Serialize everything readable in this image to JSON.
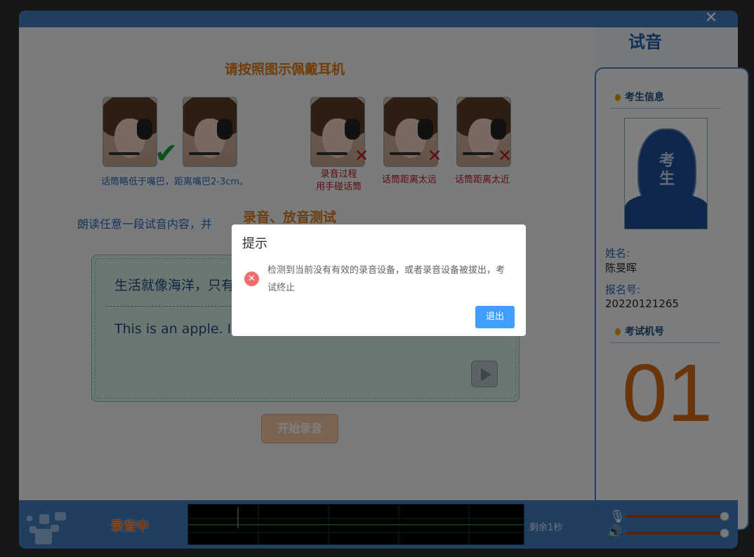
{
  "window": {
    "close_icon": "close-icon"
  },
  "headset": {
    "title": "请按照图示佩戴耳机",
    "correct_caption": "话筒略低于嘴巴，距离嘴巴2-3cm。",
    "wrong_captions": [
      {
        "line1": "录音过程",
        "line2": "用手碰话筒"
      },
      {
        "line1": "话筒距离太远",
        "line2": ""
      },
      {
        "line1": "话筒距离太近",
        "line2": ""
      }
    ],
    "marks": {
      "ok": "✔",
      "bad": "✕"
    }
  },
  "test": {
    "title": "录音、放音测试",
    "instruction": "朗读任意一段试音内容，并",
    "sample_cn": "生活就像海洋，只有",
    "sample_en": "This is an apple. I l",
    "start_button": "开始录音"
  },
  "sidebar": {
    "title": "试音",
    "candidate_header": "考生信息",
    "photo_label": "考生",
    "name_label": "姓名:",
    "name_value": "陈旻晖",
    "reg_label": "报名号:",
    "reg_value": "20220121265",
    "seat_header": "考试机号",
    "seat_value": "01"
  },
  "bottom": {
    "status": "录音中",
    "remaining": "剩余1秒",
    "mic_level": 0.95,
    "speaker_level": 0.95
  },
  "dialog": {
    "title": "提示",
    "message": "检测到当前没有有效的录音设备，或者录音设备被拔出，考试终止",
    "button": "退出"
  },
  "colors": {
    "accent": "#3f7cc0",
    "orange": "#e07a10",
    "error": "#f56c6c",
    "primary": "#409eff"
  }
}
